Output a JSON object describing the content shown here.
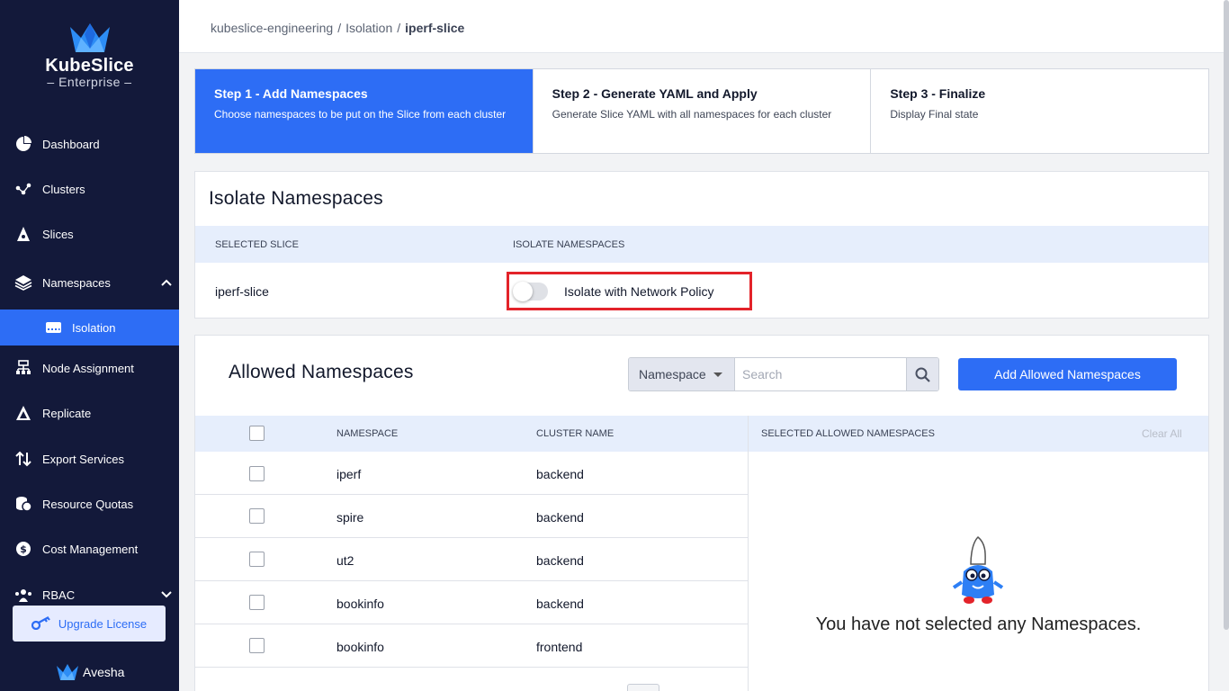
{
  "brand": {
    "name": "KubeSlice",
    "edition": "Enterprise"
  },
  "breadcrumb": {
    "part1": "kubeslice-engineering",
    "part2": "Isolation",
    "current": "iperf-slice",
    "separator": "/"
  },
  "sidebar": {
    "items": [
      {
        "label": "Dashboard",
        "icon": "pie-chart-icon"
      },
      {
        "label": "Clusters",
        "icon": "cluster-icon"
      },
      {
        "label": "Slices",
        "icon": "slice-icon"
      },
      {
        "label": "Namespaces",
        "icon": "layers-icon"
      },
      {
        "label": "Isolation",
        "icon": "server-icon"
      },
      {
        "label": "Node Assignment",
        "icon": "node-icon"
      },
      {
        "label": "Replicate",
        "icon": "replicate-icon"
      },
      {
        "label": "Export Services",
        "icon": "arrows-updown-icon"
      },
      {
        "label": "Resource Quotas",
        "icon": "coins-icon"
      },
      {
        "label": "Cost Management",
        "icon": "dollar-icon"
      },
      {
        "label": "RBAC",
        "icon": "users-icon"
      }
    ],
    "upgrade_label": "Upgrade License",
    "footer_brand": "Avesha"
  },
  "stepper": [
    {
      "title": "Step 1 - Add Namespaces",
      "desc": "Choose namespaces to be put on the Slice from each cluster"
    },
    {
      "title": "Step 2 - Generate YAML and Apply",
      "desc": "Generate Slice YAML with all namespaces for each cluster"
    },
    {
      "title": "Step 3 - Finalize",
      "desc": "Display Final state"
    }
  ],
  "isolate": {
    "title": "Isolate Namespaces",
    "col_slice": "SELECTED SLICE",
    "col_isolate": "ISOLATE NAMESPACES",
    "slice_value": "iperf-slice",
    "toggle_label": "Isolate with Network Policy",
    "toggle_on": false
  },
  "allowed": {
    "title": "Allowed Namespaces",
    "filter_label": "Namespace",
    "search_placeholder": "Search",
    "add_button": "Add Allowed Namespaces",
    "col_namespace": "NAMESPACE",
    "col_cluster": "CLUSTER NAME",
    "col_selected": "SELECTED ALLOWED NAMESPACES",
    "clear_all": "Clear All",
    "rows": [
      {
        "namespace": "iperf",
        "cluster": "backend"
      },
      {
        "namespace": "spire",
        "cluster": "backend"
      },
      {
        "namespace": "ut2",
        "cluster": "backend"
      },
      {
        "namespace": "bookinfo",
        "cluster": "backend"
      },
      {
        "namespace": "bookinfo",
        "cluster": "frontend"
      }
    ],
    "empty_message": "You have not selected any Namespaces."
  },
  "colors": {
    "primary": "#2d6df5",
    "sidebar": "#13193a",
    "highlight": "#e3232a"
  }
}
